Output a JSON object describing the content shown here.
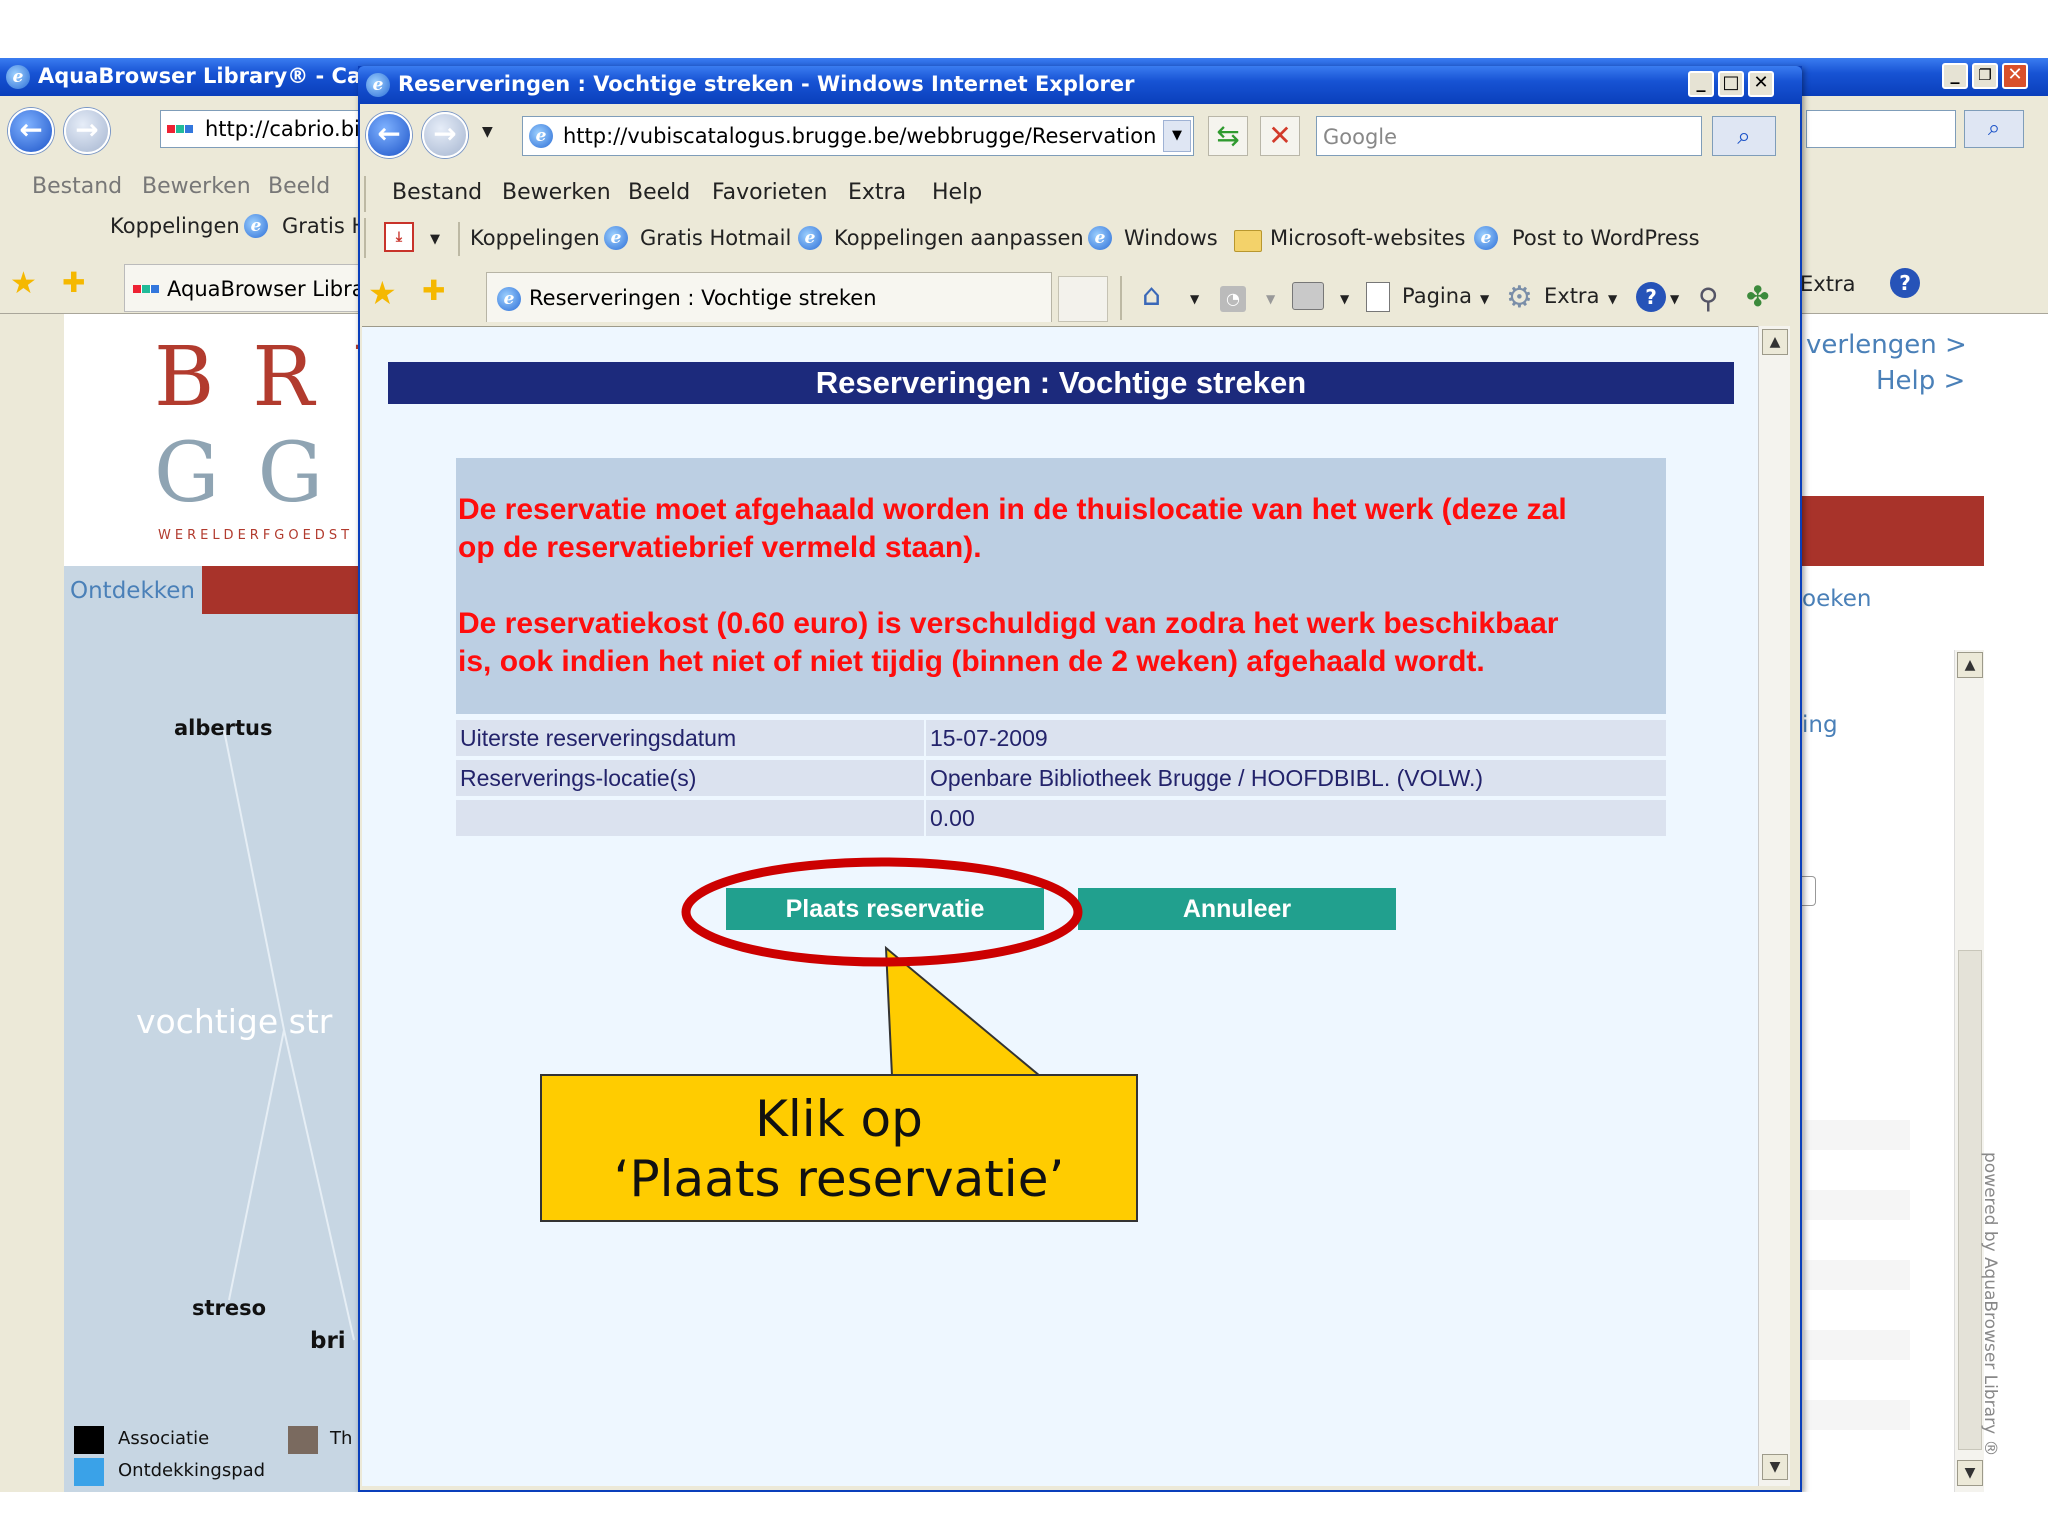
{
  "back_window": {
    "title": "AquaBrowser Library® - Cal",
    "address": "http://cabrio.bi",
    "menu": [
      "Bestand",
      "Bewerken",
      "Beeld"
    ],
    "links": [
      "Koppelingen",
      "Gratis H"
    ],
    "tab": "AquaBrowser Librai",
    "tools_right": "Extra",
    "logo_line1": "B R U",
    "logo_line2": "G G E",
    "logo_sub": "WERELDERFGOEDST",
    "ontdekken": "Ontdekken",
    "words": {
      "albertus": "albertus",
      "vochtige": "vochtige str",
      "streso": "streso",
      "bri": "bri"
    },
    "legend": {
      "associatie": "Associatie",
      "th": "Th",
      "ontdekkingspad": "Ontdekkingspad"
    },
    "right_links": {
      "verlengen": "verlengen >",
      "help": "Help >",
      "zoeken": "oeken",
      "ing": "ing"
    },
    "powered": "powered by AquaBrowser Library ®"
  },
  "front_window": {
    "title": "Reserveringen : Vochtige streken - Windows Internet Explorer",
    "address": "http://vubiscatalogus.brugge.be/webbrugge/ReservationBody",
    "search_placeholder": "Google",
    "menu": [
      "Bestand",
      "Bewerken",
      "Beeld",
      "Favorieten",
      "Extra",
      "Help"
    ],
    "links": [
      "Koppelingen",
      "Gratis Hotmail",
      "Koppelingen aanpassen",
      "Windows",
      "Microsoft-websites",
      "Post to WordPress"
    ],
    "tab": "Reserveringen : Vochtige streken",
    "tools": {
      "pagina": "Pagina",
      "extra": "Extra"
    }
  },
  "page": {
    "header": "Reserveringen : Vochtige streken",
    "notice1_line1": "De reservatie moet afgehaald worden in de thuislocatie van het werk (deze zal",
    "notice1_line2": "op de reservatiebrief vermeld staan).",
    "notice2_line1": "De reservatiekost (0.60 euro) is verschuldigd van zodra het werk beschikbaar",
    "notice2_line2": "is, ook indien het niet of niet tijdig (binnen de 2 weken) afgehaald wordt.",
    "rows": [
      {
        "label": "Uiterste reserveringsdatum",
        "value": "15-07-2009"
      },
      {
        "label": "Reserverings-locatie(s)",
        "value": "Openbare Bibliotheek Brugge / HOOFDBIBL. (VOLW.)"
      },
      {
        "label": "",
        "value": "0.00"
      }
    ],
    "btn_place": "Plaats reservatie",
    "btn_cancel": "Annuleer"
  },
  "callout": {
    "line1": "Klik op",
    "line2": "‘Plaats reservatie’"
  },
  "colors": {
    "header_bg": "#1c2a7c",
    "notice_text": "#ff0d0d",
    "button_bg": "#21a08e",
    "callout_bg": "#ffcc00",
    "highlight_ellipse": "#cc0000",
    "brand_red": "#a8332a"
  }
}
